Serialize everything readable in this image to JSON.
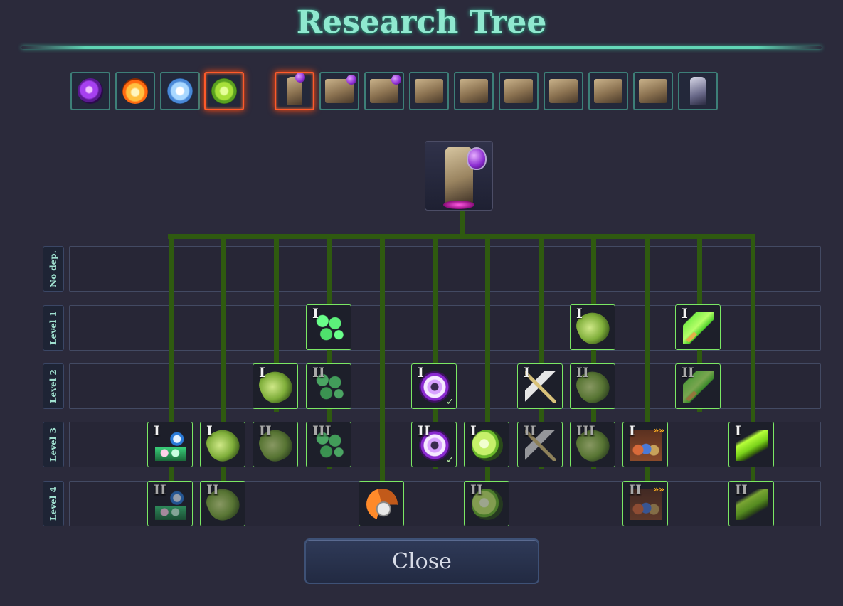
{
  "title": "Research Tree",
  "category_tabs": [
    {
      "icon": "arcane-orb-icon",
      "selected": false
    },
    {
      "icon": "fire-orb-icon",
      "selected": false
    },
    {
      "icon": "frost-orb-icon",
      "selected": false
    },
    {
      "icon": "nature-orb-icon",
      "selected": true
    }
  ],
  "building_tabs": [
    {
      "icon": "mage-tower-icon",
      "selected": true
    },
    {
      "icon": "workshop-building-icon",
      "selected": false
    },
    {
      "icon": "house-building-icon",
      "selected": false
    },
    {
      "icon": "hall-building-icon",
      "selected": false
    },
    {
      "icon": "forge-building-icon",
      "selected": false
    },
    {
      "icon": "barracks-building-icon",
      "selected": false
    },
    {
      "icon": "archery-building-icon",
      "selected": false
    },
    {
      "icon": "hunter-lodge-icon",
      "selected": false
    },
    {
      "icon": "fortress-building-icon",
      "selected": false
    },
    {
      "icon": "shrine-building-icon",
      "selected": false
    }
  ],
  "root_node": {
    "icon": "mage-tower-potion-icon"
  },
  "row_labels": [
    "No dep.",
    "Level 1",
    "Level 2",
    "Level 3",
    "Level 4"
  ],
  "nodes": {
    "n1": {
      "tier": "I",
      "icon": "clover-icon"
    },
    "n2": {
      "tier": "I",
      "icon": "leaf-spray-icon"
    },
    "n3": {
      "tier": "I",
      "icon": "green-sword-icon"
    },
    "n4": {
      "tier": "I",
      "icon": "leaf-spray-icon"
    },
    "n5": {
      "tier": "II",
      "icon": "clover-icon"
    },
    "n6": {
      "tier": "I",
      "icon": "arcane-eye-icon",
      "checked": true
    },
    "n7": {
      "tier": "I",
      "icon": "sword-axe-icon"
    },
    "n8": {
      "tier": "II",
      "icon": "leaf-spray-icon"
    },
    "n9": {
      "tier": "II",
      "icon": "green-sword-icon"
    },
    "n10": {
      "tier": "I",
      "icon": "flower-refresh-icon"
    },
    "n11": {
      "tier": "I",
      "icon": "leaf-spray-icon"
    },
    "n12": {
      "tier": "II",
      "icon": "leaf-spray-icon"
    },
    "n13": {
      "tier": "III",
      "icon": "clover-icon"
    },
    "n14": {
      "tier": "II",
      "icon": "arcane-eye-icon",
      "checked": true
    },
    "n15": {
      "tier": "I",
      "icon": "potion-icon"
    },
    "n16": {
      "tier": "II",
      "icon": "sword-axe-icon"
    },
    "n17": {
      "tier": "III",
      "icon": "leaf-spray-icon"
    },
    "n18": {
      "tier": "I",
      "icon": "crowd-speed-icon"
    },
    "n19": {
      "tier": "I",
      "icon": "green-blade-icon"
    },
    "n20": {
      "tier": "II",
      "icon": "flower-refresh-icon"
    },
    "n21": {
      "tier": "II",
      "icon": "leaf-spray-icon"
    },
    "n22": {
      "tier": "",
      "icon": "stopwatch-icon"
    },
    "n23": {
      "tier": "II",
      "icon": "potion-icon"
    },
    "n24": {
      "tier": "II",
      "icon": "crowd-speed-icon"
    },
    "n25": {
      "tier": "II",
      "icon": "green-blade-icon"
    }
  },
  "close_label": "Close",
  "colors": {
    "background": "#2b2a3b",
    "title": "#8fe8cf",
    "connector": "#2f5a10",
    "node_border": "#7be864",
    "selected_tab_border": "#ff5a2a"
  }
}
